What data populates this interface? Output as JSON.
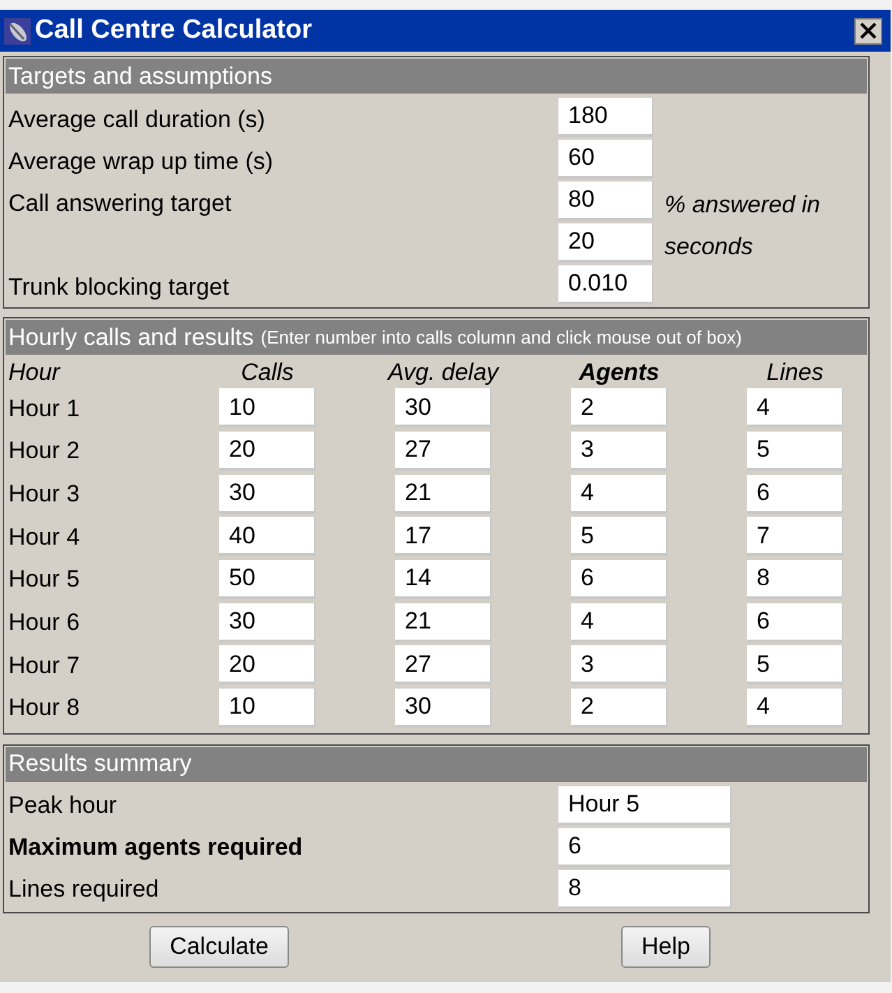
{
  "window": {
    "title": "Call Centre Calculator"
  },
  "targets": {
    "heading": "Targets and assumptions",
    "rows": [
      {
        "label": "Average call duration (s)",
        "value": "180"
      },
      {
        "label": "Average wrap up time (s)",
        "value": "60"
      },
      {
        "label": "Call answering target",
        "value": "80",
        "note": "% answered in"
      },
      {
        "value": "20",
        "note": "seconds"
      },
      {
        "label": "Trunk blocking target",
        "value": "0.010"
      }
    ]
  },
  "hourly": {
    "heading": "Hourly calls and results",
    "hint": "(Enter number into calls column and click mouse out of box)",
    "columns": [
      {
        "label": "Hour",
        "bold": false
      },
      {
        "label": "Calls",
        "bold": false
      },
      {
        "label": "Avg. delay",
        "bold": false
      },
      {
        "label": "Agents",
        "bold": true
      },
      {
        "label": "Lines",
        "bold": false
      }
    ],
    "rows": [
      {
        "hour": "Hour 1",
        "values": [
          "10",
          "30",
          "2",
          "4"
        ]
      },
      {
        "hour": "Hour 2",
        "values": [
          "20",
          "27",
          "3",
          "5"
        ]
      },
      {
        "hour": "Hour 3",
        "values": [
          "30",
          "21",
          "4",
          "6"
        ]
      },
      {
        "hour": "Hour 4",
        "values": [
          "40",
          "17",
          "5",
          "7"
        ]
      },
      {
        "hour": "Hour 5",
        "values": [
          "50",
          "14",
          "6",
          "8"
        ]
      },
      {
        "hour": "Hour 6",
        "values": [
          "30",
          "21",
          "4",
          "6"
        ]
      },
      {
        "hour": "Hour 7",
        "values": [
          "20",
          "27",
          "3",
          "5"
        ]
      },
      {
        "hour": "Hour 8",
        "values": [
          "10",
          "30",
          "2",
          "4"
        ]
      }
    ]
  },
  "summary": {
    "heading": "Results summary",
    "rows": [
      {
        "label": "Peak hour",
        "value": "Hour 5",
        "bold": false
      },
      {
        "label": "Maximum agents required",
        "value": "6",
        "bold": true
      },
      {
        "label": "Lines required",
        "value": "8",
        "bold": false
      }
    ]
  },
  "buttons": [
    "Calculate",
    "Help"
  ]
}
